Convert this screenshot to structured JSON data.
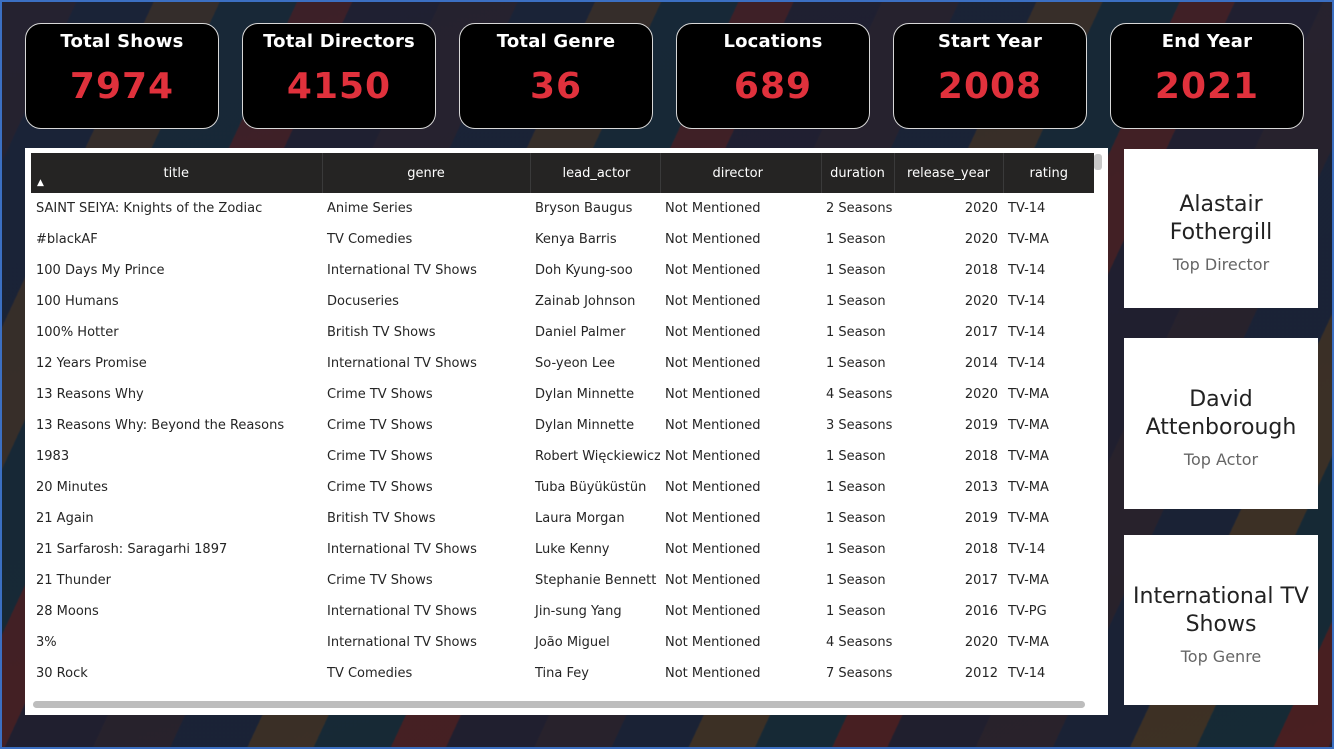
{
  "kpis": [
    {
      "label": "Total Shows",
      "value": "7974"
    },
    {
      "label": "Total Directors",
      "value": "4150"
    },
    {
      "label": "Total Genre",
      "value": "36"
    },
    {
      "label": "Locations",
      "value": "689"
    },
    {
      "label": "Start Year",
      "value": "2008"
    },
    {
      "label": "End Year",
      "value": "2021"
    }
  ],
  "table": {
    "columns": [
      "title",
      "genre",
      "lead_actor",
      "director",
      "duration",
      "release_year",
      "rating"
    ],
    "rows": [
      [
        "SAINT SEIYA: Knights of the Zodiac",
        "Anime Series",
        "Bryson Baugus",
        "Not Mentioned",
        "2 Seasons",
        "2020",
        "TV-14"
      ],
      [
        "#blackAF",
        "TV Comedies",
        "Kenya Barris",
        "Not Mentioned",
        "1 Season",
        "2020",
        "TV-MA"
      ],
      [
        "100 Days My Prince",
        "International TV Shows",
        "Doh Kyung-soo",
        "Not Mentioned",
        "1 Season",
        "2018",
        "TV-14"
      ],
      [
        "100 Humans",
        "Docuseries",
        "Zainab Johnson",
        "Not Mentioned",
        "1 Season",
        "2020",
        "TV-14"
      ],
      [
        "100% Hotter",
        "British TV Shows",
        "Daniel Palmer",
        "Not Mentioned",
        "1 Season",
        "2017",
        "TV-14"
      ],
      [
        "12 Years Promise",
        "International TV Shows",
        "So-yeon Lee",
        "Not Mentioned",
        "1 Season",
        "2014",
        "TV-14"
      ],
      [
        "13 Reasons Why",
        "Crime TV Shows",
        "Dylan Minnette",
        "Not Mentioned",
        "4 Seasons",
        "2020",
        "TV-MA"
      ],
      [
        "13 Reasons Why: Beyond the Reasons",
        "Crime TV Shows",
        "Dylan Minnette",
        "Not Mentioned",
        "3 Seasons",
        "2019",
        "TV-MA"
      ],
      [
        "1983",
        "Crime TV Shows",
        "Robert Więckiewicz",
        "Not Mentioned",
        "1 Season",
        "2018",
        "TV-MA"
      ],
      [
        "20 Minutes",
        "Crime TV Shows",
        "Tuba Büyüküstün",
        "Not Mentioned",
        "1 Season",
        "2013",
        "TV-MA"
      ],
      [
        "21 Again",
        "British TV Shows",
        "Laura Morgan",
        "Not Mentioned",
        "1 Season",
        "2019",
        "TV-MA"
      ],
      [
        "21 Sarfarosh: Saragarhi 1897",
        "International TV Shows",
        "Luke Kenny",
        "Not Mentioned",
        "1 Season",
        "2018",
        "TV-14"
      ],
      [
        "21 Thunder",
        "Crime TV Shows",
        "Stephanie Bennett",
        "Not Mentioned",
        "1 Season",
        "2017",
        "TV-MA"
      ],
      [
        "28 Moons",
        "International TV Shows",
        "Jin-sung Yang",
        "Not Mentioned",
        "1 Season",
        "2016",
        "TV-PG"
      ],
      [
        "3%",
        "International TV Shows",
        "João Miguel",
        "Not Mentioned",
        "4 Seasons",
        "2020",
        "TV-MA"
      ],
      [
        "30 Rock",
        "TV Comedies",
        "Tina Fey",
        "Not Mentioned",
        "7 Seasons",
        "2012",
        "TV-14"
      ]
    ]
  },
  "side_cards": [
    {
      "name": "Alastair Fothergill",
      "subtitle": "Top Director"
    },
    {
      "name": "David Attenborough",
      "subtitle": "Top Actor"
    },
    {
      "name": "International TV Shows",
      "subtitle": "Top Genre"
    }
  ]
}
